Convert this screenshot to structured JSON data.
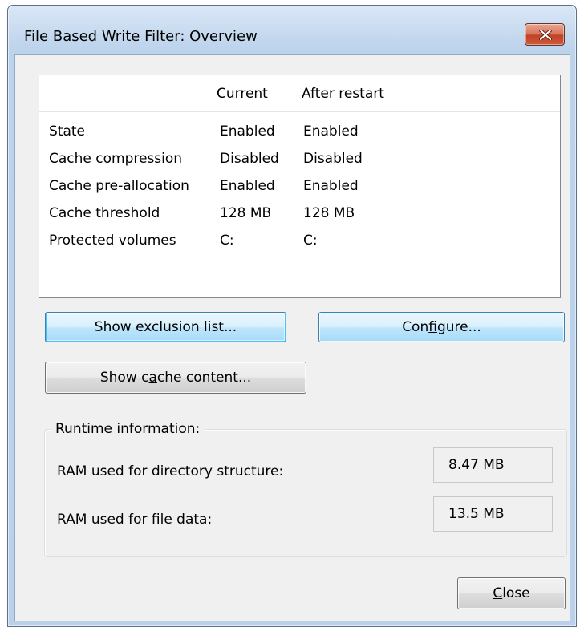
{
  "window": {
    "title": "File Based Write Filter: Overview"
  },
  "overview": {
    "columns": [
      "",
      "Current",
      "After restart"
    ],
    "rows": [
      {
        "name": "State",
        "current": "Enabled",
        "after": "Enabled"
      },
      {
        "name": "Cache compression",
        "current": "Disabled",
        "after": "Disabled"
      },
      {
        "name": "Cache pre-allocation",
        "current": "Enabled",
        "after": "Enabled"
      },
      {
        "name": "Cache threshold",
        "current": "128 MB",
        "after": "128 MB"
      },
      {
        "name": "Protected volumes",
        "current": "C:",
        "after": "C:"
      }
    ]
  },
  "buttons": {
    "exclusion": "Show exclusion list...",
    "configure_pre": "Con",
    "configure_accel": "f",
    "configure_post": "igure...",
    "cache_pre": "Show c",
    "cache_accel": "a",
    "cache_post": "che content...",
    "close_accel": "C",
    "close_post": "lose"
  },
  "runtime": {
    "legend": "Runtime information:",
    "dir_label": "RAM used for directory structure:",
    "dir_value": "8.47 MB",
    "file_label": "RAM used for file data:",
    "file_value": "13.5 MB"
  },
  "icons": {
    "close": "close-x-icon"
  }
}
